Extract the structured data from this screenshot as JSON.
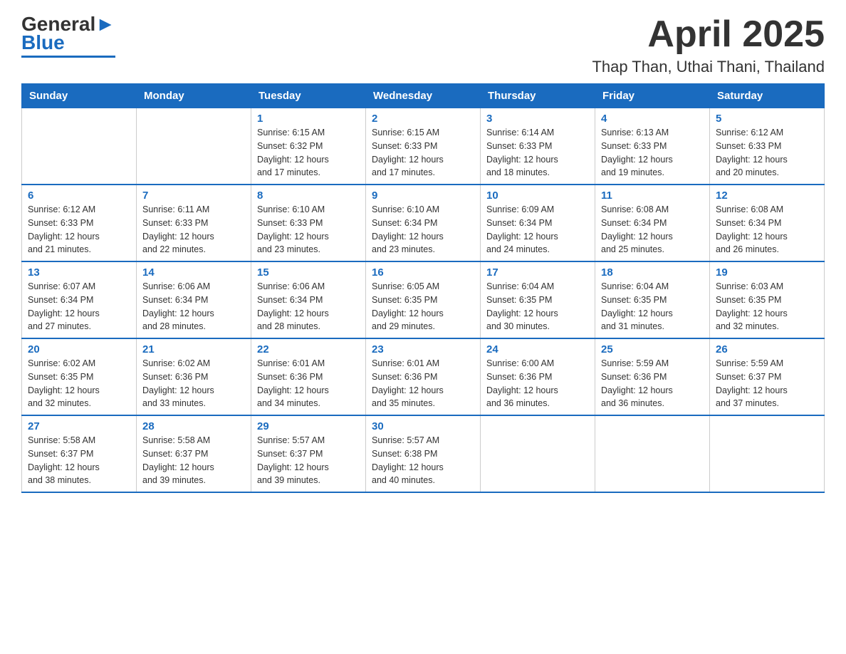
{
  "header": {
    "logo_text_black": "General",
    "logo_text_blue": "Blue",
    "title": "April 2025",
    "subtitle": "Thap Than, Uthai Thani, Thailand"
  },
  "calendar": {
    "days_of_week": [
      "Sunday",
      "Monday",
      "Tuesday",
      "Wednesday",
      "Thursday",
      "Friday",
      "Saturday"
    ],
    "weeks": [
      [
        {
          "day": "",
          "info": ""
        },
        {
          "day": "",
          "info": ""
        },
        {
          "day": "1",
          "info": "Sunrise: 6:15 AM\nSunset: 6:32 PM\nDaylight: 12 hours\nand 17 minutes."
        },
        {
          "day": "2",
          "info": "Sunrise: 6:15 AM\nSunset: 6:33 PM\nDaylight: 12 hours\nand 17 minutes."
        },
        {
          "day": "3",
          "info": "Sunrise: 6:14 AM\nSunset: 6:33 PM\nDaylight: 12 hours\nand 18 minutes."
        },
        {
          "day": "4",
          "info": "Sunrise: 6:13 AM\nSunset: 6:33 PM\nDaylight: 12 hours\nand 19 minutes."
        },
        {
          "day": "5",
          "info": "Sunrise: 6:12 AM\nSunset: 6:33 PM\nDaylight: 12 hours\nand 20 minutes."
        }
      ],
      [
        {
          "day": "6",
          "info": "Sunrise: 6:12 AM\nSunset: 6:33 PM\nDaylight: 12 hours\nand 21 minutes."
        },
        {
          "day": "7",
          "info": "Sunrise: 6:11 AM\nSunset: 6:33 PM\nDaylight: 12 hours\nand 22 minutes."
        },
        {
          "day": "8",
          "info": "Sunrise: 6:10 AM\nSunset: 6:33 PM\nDaylight: 12 hours\nand 23 minutes."
        },
        {
          "day": "9",
          "info": "Sunrise: 6:10 AM\nSunset: 6:34 PM\nDaylight: 12 hours\nand 23 minutes."
        },
        {
          "day": "10",
          "info": "Sunrise: 6:09 AM\nSunset: 6:34 PM\nDaylight: 12 hours\nand 24 minutes."
        },
        {
          "day": "11",
          "info": "Sunrise: 6:08 AM\nSunset: 6:34 PM\nDaylight: 12 hours\nand 25 minutes."
        },
        {
          "day": "12",
          "info": "Sunrise: 6:08 AM\nSunset: 6:34 PM\nDaylight: 12 hours\nand 26 minutes."
        }
      ],
      [
        {
          "day": "13",
          "info": "Sunrise: 6:07 AM\nSunset: 6:34 PM\nDaylight: 12 hours\nand 27 minutes."
        },
        {
          "day": "14",
          "info": "Sunrise: 6:06 AM\nSunset: 6:34 PM\nDaylight: 12 hours\nand 28 minutes."
        },
        {
          "day": "15",
          "info": "Sunrise: 6:06 AM\nSunset: 6:34 PM\nDaylight: 12 hours\nand 28 minutes."
        },
        {
          "day": "16",
          "info": "Sunrise: 6:05 AM\nSunset: 6:35 PM\nDaylight: 12 hours\nand 29 minutes."
        },
        {
          "day": "17",
          "info": "Sunrise: 6:04 AM\nSunset: 6:35 PM\nDaylight: 12 hours\nand 30 minutes."
        },
        {
          "day": "18",
          "info": "Sunrise: 6:04 AM\nSunset: 6:35 PM\nDaylight: 12 hours\nand 31 minutes."
        },
        {
          "day": "19",
          "info": "Sunrise: 6:03 AM\nSunset: 6:35 PM\nDaylight: 12 hours\nand 32 minutes."
        }
      ],
      [
        {
          "day": "20",
          "info": "Sunrise: 6:02 AM\nSunset: 6:35 PM\nDaylight: 12 hours\nand 32 minutes."
        },
        {
          "day": "21",
          "info": "Sunrise: 6:02 AM\nSunset: 6:36 PM\nDaylight: 12 hours\nand 33 minutes."
        },
        {
          "day": "22",
          "info": "Sunrise: 6:01 AM\nSunset: 6:36 PM\nDaylight: 12 hours\nand 34 minutes."
        },
        {
          "day": "23",
          "info": "Sunrise: 6:01 AM\nSunset: 6:36 PM\nDaylight: 12 hours\nand 35 minutes."
        },
        {
          "day": "24",
          "info": "Sunrise: 6:00 AM\nSunset: 6:36 PM\nDaylight: 12 hours\nand 36 minutes."
        },
        {
          "day": "25",
          "info": "Sunrise: 5:59 AM\nSunset: 6:36 PM\nDaylight: 12 hours\nand 36 minutes."
        },
        {
          "day": "26",
          "info": "Sunrise: 5:59 AM\nSunset: 6:37 PM\nDaylight: 12 hours\nand 37 minutes."
        }
      ],
      [
        {
          "day": "27",
          "info": "Sunrise: 5:58 AM\nSunset: 6:37 PM\nDaylight: 12 hours\nand 38 minutes."
        },
        {
          "day": "28",
          "info": "Sunrise: 5:58 AM\nSunset: 6:37 PM\nDaylight: 12 hours\nand 39 minutes."
        },
        {
          "day": "29",
          "info": "Sunrise: 5:57 AM\nSunset: 6:37 PM\nDaylight: 12 hours\nand 39 minutes."
        },
        {
          "day": "30",
          "info": "Sunrise: 5:57 AM\nSunset: 6:38 PM\nDaylight: 12 hours\nand 40 minutes."
        },
        {
          "day": "",
          "info": ""
        },
        {
          "day": "",
          "info": ""
        },
        {
          "day": "",
          "info": ""
        }
      ]
    ]
  }
}
